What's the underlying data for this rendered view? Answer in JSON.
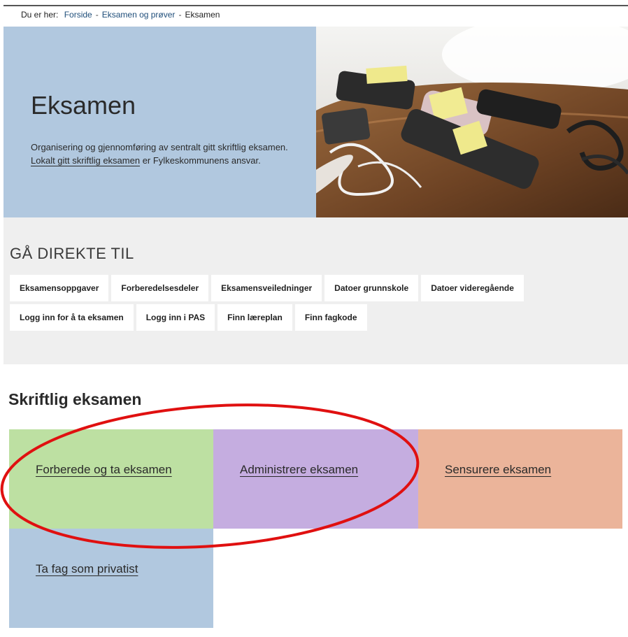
{
  "breadcrumb": {
    "prefix": "Du er her:",
    "items": [
      "Forside",
      "Eksamen og prøver",
      "Eksamen"
    ],
    "separator": "-"
  },
  "hero": {
    "title": "Eksamen",
    "desc_line1": "Organisering og gjennomføring av sentralt gitt skriftlig eksamen.",
    "desc_link": "Lokalt gitt skriftlig eksamen",
    "desc_line2_rest": " er Fylkeskommunens ansvar.",
    "background_color": "#b1c8df"
  },
  "quick_links": {
    "heading": "GÅ DIREKTE TIL",
    "row1": [
      "Eksamensoppgaver",
      "Forberedelsesdeler",
      "Eksamensveiledninger",
      "Datoer grunnskole",
      "Datoer videregående"
    ],
    "row2": [
      "Logg inn for å ta eksamen",
      "Logg inn i PAS",
      "Finn læreplan",
      "Finn fagkode"
    ]
  },
  "section": {
    "title": "Skriftlig eksamen",
    "tiles": [
      {
        "label": "Forberede og ta eksamen",
        "color": "#bde0a2"
      },
      {
        "label": "Administrere eksamen",
        "color": "#c5ade0"
      },
      {
        "label": "Sensurere eksamen",
        "color": "#ebb49a"
      },
      {
        "label": "Ta fag som privatist",
        "color": "#b1c8df"
      }
    ]
  },
  "annotation": {
    "shape": "ellipse",
    "color": "#e01010"
  }
}
